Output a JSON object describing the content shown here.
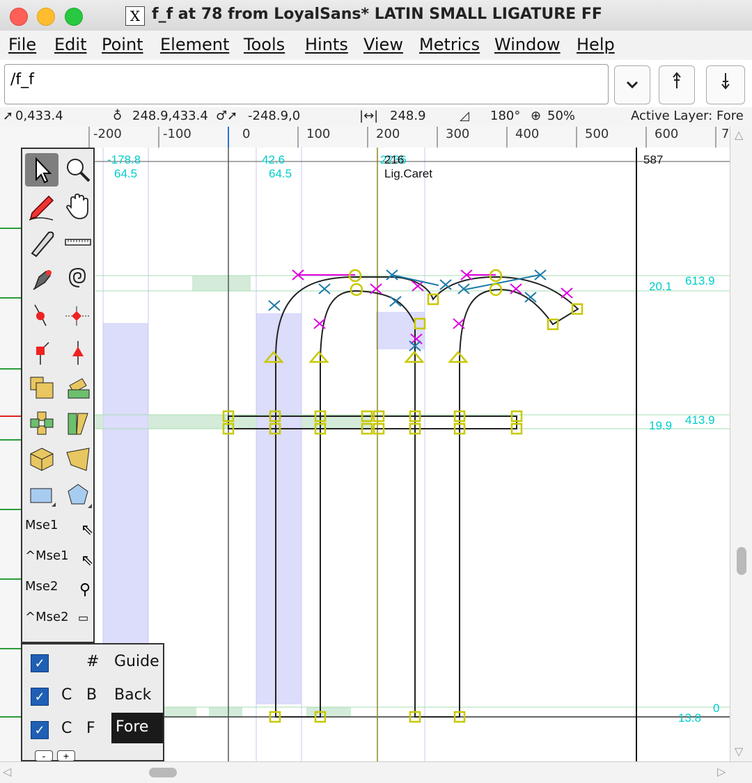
{
  "window": {
    "title": "f_f at 78 from LoyalSans* LATIN SMALL LIGATURE FF"
  },
  "menu": [
    "File",
    "Edit",
    "Point",
    "Element",
    "Tools",
    "Hints",
    "View",
    "Metrics",
    "Window",
    "Help"
  ],
  "glyph_input": {
    "value": "/f_f"
  },
  "infobar": {
    "cursor_pos": "0,433.4",
    "point_pos": "248.9,433.4",
    "offset": "-248.9,0",
    "distance": "248.9",
    "angle": "180°",
    "zoom": "50%",
    "active_layer": "Active Layer: Fore"
  },
  "ruler_labels": [
    "-200",
    "-100",
    "0",
    "100",
    "200",
    "300",
    "400",
    "500",
    "600",
    "7"
  ],
  "canvas_labels": {
    "left_top1": "-178.8",
    "left_top2": "64.5",
    "mid_top1": "42.6",
    "mid_top2": "64.5",
    "caret_num": "216",
    "caret_overlap": "2236",
    "caret_label": "Lig.Caret",
    "advance": "587",
    "hint_top_a": "20.1",
    "hint_top_b": "613.9",
    "hint_mid_a": "19.9",
    "hint_mid_b": "413.9",
    "hint_bottom_a": "0",
    "hint_bottom_b": "13.8"
  },
  "mouse_labels": [
    "Mse1",
    "^Mse1",
    "Mse2",
    "^Mse2"
  ],
  "layers": [
    {
      "c": "",
      "b": "#",
      "name": "Guide"
    },
    {
      "c": "C",
      "b": "B",
      "name": "Back"
    },
    {
      "c": "C",
      "b": "F",
      "name": "Fore"
    }
  ],
  "layer_buttons": [
    "-",
    "+"
  ],
  "colors": {
    "hint_blue": "#d8d8ff",
    "hint_green": "#cfe8d4",
    "point_yellow": "#c8c800",
    "control_magenta": "#e000e0",
    "cyan_text": "#00cccc"
  }
}
